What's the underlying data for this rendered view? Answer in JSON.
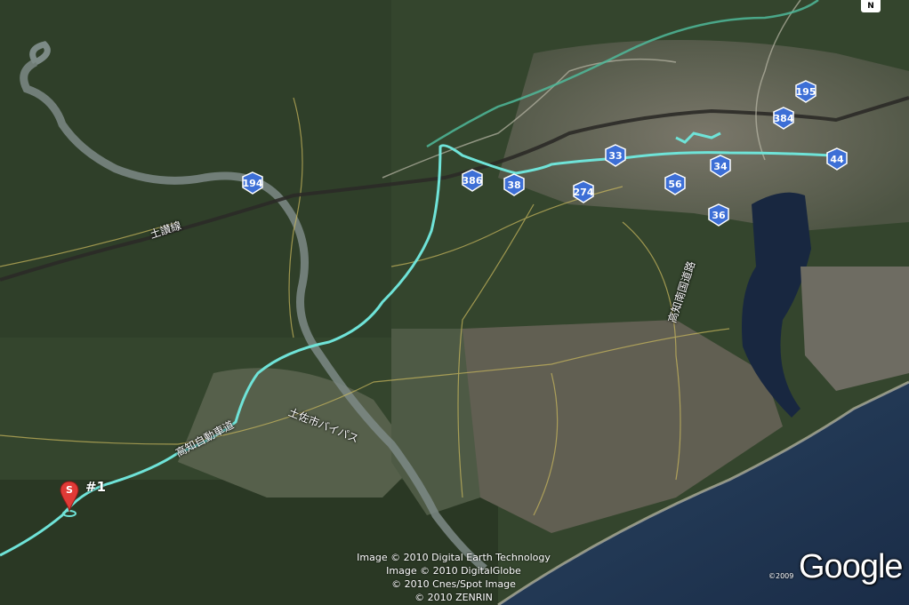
{
  "map": {
    "compass": "N",
    "start_marker": {
      "letter": "S",
      "label": "#1"
    },
    "road_shields": [
      "194",
      "386",
      "38",
      "274",
      "33",
      "56",
      "34",
      "36",
      "384",
      "195",
      "44"
    ],
    "place_labels": {
      "rail_line": "土讃線",
      "highway": "高知自動車道",
      "bypass": "土佐市バイパス",
      "coastal_road": "高知南国道路"
    },
    "attribution": [
      "Image © 2010 Digital Earth Technology",
      "Image © 2010 DigitalGlobe",
      "© 2010 Cnes/Spot Image",
      "© 2010 ZENRIN"
    ],
    "google_year": "©2009",
    "google_logo": "Google",
    "colors": {
      "route": "#6fe3d8",
      "shield": "#3d6fd6",
      "marker": "#e03a36",
      "sea": "#1f3350",
      "forest": "#33432c",
      "urban": "#6c6a5e"
    }
  }
}
